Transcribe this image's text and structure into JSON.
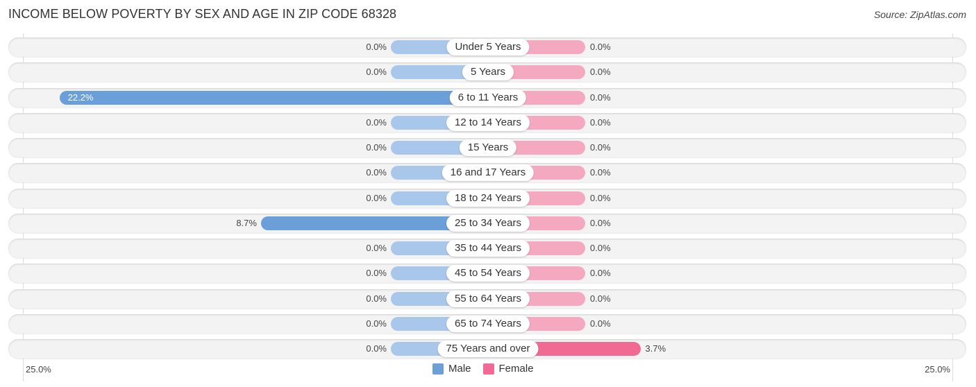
{
  "header": {
    "title": "INCOME BELOW POVERTY BY SEX AND AGE IN ZIP CODE 68328",
    "source": "Source: ZipAtlas.com"
  },
  "colors": {
    "male": "#6a9fd9",
    "male_light": "#a9c7ea",
    "female": "#f06a93",
    "female_light": "#f5a9c1"
  },
  "chart_data": {
    "type": "bar",
    "title": "INCOME BELOW POVERTY BY SEX AND AGE IN ZIP CODE 68328",
    "orientation": "horizontal-diverging",
    "categories": [
      "Under 5 Years",
      "5 Years",
      "6 to 11 Years",
      "12 to 14 Years",
      "15 Years",
      "16 and 17 Years",
      "18 to 24 Years",
      "25 to 34 Years",
      "35 to 44 Years",
      "45 to 54 Years",
      "55 to 64 Years",
      "65 to 74 Years",
      "75 Years and over"
    ],
    "series": [
      {
        "name": "Male",
        "values": [
          0.0,
          0.0,
          22.2,
          0.0,
          0.0,
          0.0,
          0.0,
          8.7,
          0.0,
          0.0,
          0.0,
          0.0,
          0.0
        ]
      },
      {
        "name": "Female",
        "values": [
          0.0,
          0.0,
          0.0,
          0.0,
          0.0,
          0.0,
          0.0,
          0.0,
          0.0,
          0.0,
          0.0,
          0.0,
          3.7
        ]
      }
    ],
    "value_labels": {
      "male": [
        "0.0%",
        "0.0%",
        "22.2%",
        "0.0%",
        "0.0%",
        "0.0%",
        "0.0%",
        "8.7%",
        "0.0%",
        "0.0%",
        "0.0%",
        "0.0%",
        "0.0%"
      ],
      "female": [
        "0.0%",
        "0.0%",
        "0.0%",
        "0.0%",
        "0.0%",
        "0.0%",
        "0.0%",
        "0.0%",
        "0.0%",
        "0.0%",
        "0.0%",
        "0.0%",
        "3.7%"
      ]
    },
    "xlim": [
      -25,
      25
    ],
    "axis_labels": {
      "left": "25.0%",
      "right": "25.0%"
    },
    "legend": {
      "position": "bottom-center",
      "items": [
        "Male",
        "Female"
      ]
    }
  }
}
